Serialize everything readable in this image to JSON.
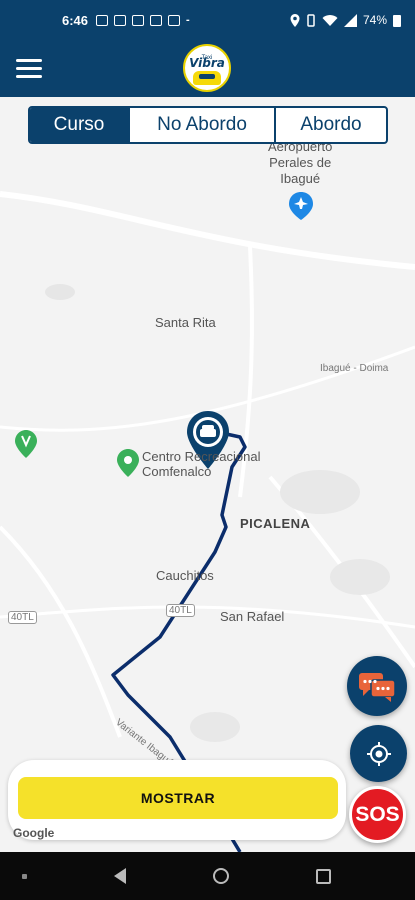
{
  "status_bar": {
    "time": "6:46",
    "battery": "74%",
    "dash": "-"
  },
  "app": {
    "logo_text": "Vibra",
    "logo_small": "Taxi"
  },
  "tabs": [
    {
      "label": "Curso",
      "active": true
    },
    {
      "label": "No Abordo",
      "active": false
    },
    {
      "label": "Abordo",
      "active": false
    }
  ],
  "map": {
    "labels": {
      "airport": "Aeropuerto Perales de Ibagué",
      "airport_line1": "Aeropuerto",
      "airport_line2": "Perales de",
      "airport_line3": "Ibagué",
      "santa_rita": "Santa Rita",
      "road_ibague": "Ibagué - Doima",
      "centro_line1": "Centro Recreacional",
      "centro_line2": "Comfenalco",
      "picalena": "PICALENA",
      "cauchitos": "Cauchitos",
      "san_rafael": "San Rafael",
      "route_40tl": "40TL",
      "route_40tl_2": "40TL",
      "variante": "Variante Ibagué-Al..."
    },
    "route_color": "#0b2d6b",
    "pin_color": "#0b416c"
  },
  "actions": {
    "show_button": "MOSTRAR",
    "sos": "SOS",
    "google": "Google"
  },
  "colors": {
    "primary": "#0b416c",
    "accent": "#f5e12a",
    "sos": "#e31b23",
    "chat_bubble": "#e8643a"
  }
}
